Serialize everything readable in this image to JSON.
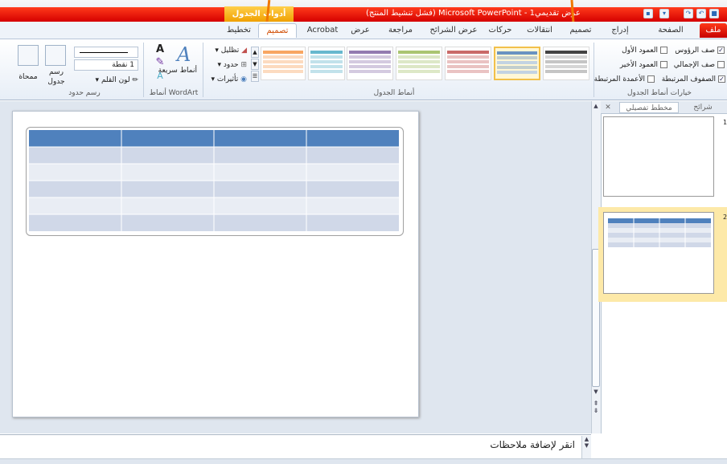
{
  "window": {
    "title": "عرض تقديمي1 - Microsoft PowerPoint (فشل تنشيط المنتج)",
    "contextual_tab_group": "أدوات الجدول"
  },
  "quick_access": [
    "save-icon",
    "undo-icon",
    "redo-icon",
    "customize-icon"
  ],
  "tabs": {
    "file": "ملف",
    "items": [
      "الصفحة الرئيسية",
      "إدراج",
      "تصميم",
      "انتقالات",
      "حركات",
      "عرض الشرائح",
      "مراجعة",
      "عرض",
      "Acrobat",
      "تصميم",
      "تخطيط"
    ]
  },
  "ribbon": {
    "style_options": {
      "label": "خيارات أنماط الجدول",
      "checks": [
        {
          "label": "صف الرؤوس",
          "checked": true
        },
        {
          "label": "العمود الأول",
          "checked": false
        },
        {
          "label": "صف الإجمالي",
          "checked": false
        },
        {
          "label": "العمود الأخير",
          "checked": false
        },
        {
          "label": "الصفوف المرتبطة",
          "checked": true
        },
        {
          "label": "الأعمدة المرتبطة",
          "checked": false
        }
      ]
    },
    "table_styles": {
      "label": "أنماط الجدول",
      "swatch_colors": [
        "#222222",
        "#4f81bd",
        "#c0504d",
        "#9bbb59",
        "#8064a2",
        "#4bacc6",
        "#f79646"
      ],
      "shading": "تظليل",
      "borders": "حدود",
      "effects": "تأثيرات"
    },
    "wordart": {
      "label": "أنماط WordArt",
      "quick_styles": "أنماط سريعة"
    },
    "draw_borders": {
      "label": "رسم حدود",
      "pen_weight": "1 نقطة",
      "pen_color": "لون القلم",
      "draw_table": "رسم جدول",
      "eraser": "ممحاة"
    }
  },
  "slides_pane": {
    "tab_slides": "شرائح",
    "tab_outline": "مخطط تفصيلي",
    "slide_numbers": [
      "1",
      "2"
    ]
  },
  "notes": {
    "placeholder": "انقر لإضافة ملاحظات"
  }
}
